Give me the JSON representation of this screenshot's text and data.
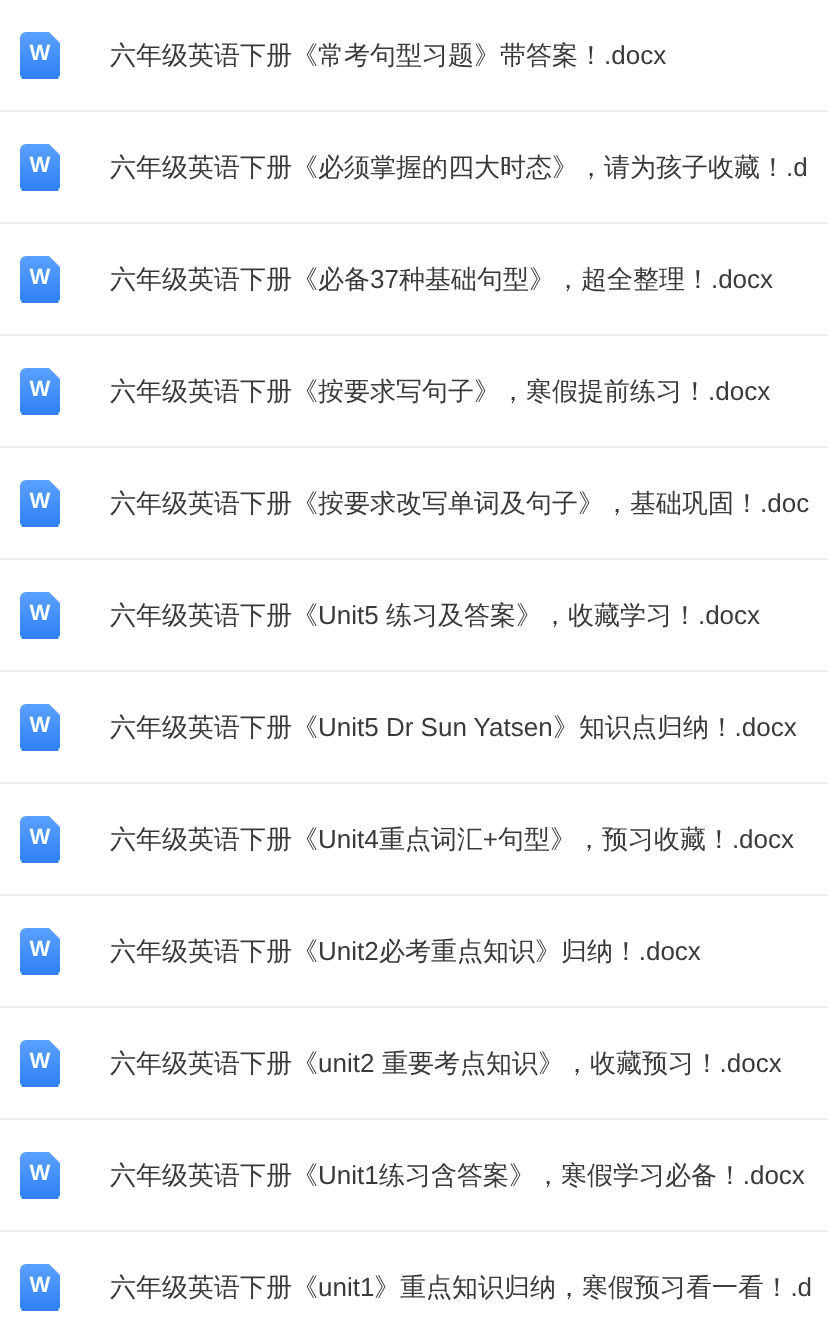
{
  "files": [
    {
      "icon_label": "W",
      "name": "六年级英语下册《常考句型习题》带答案！.docx"
    },
    {
      "icon_label": "W",
      "name": "六年级英语下册《必须掌握的四大时态》，请为孩子收藏！.d"
    },
    {
      "icon_label": "W",
      "name": "六年级英语下册《必备37种基础句型》，超全整理！.docx"
    },
    {
      "icon_label": "W",
      "name": "六年级英语下册《按要求写句子》，寒假提前练习！.docx"
    },
    {
      "icon_label": "W",
      "name": "六年级英语下册《按要求改写单词及句子》，基础巩固！.doc"
    },
    {
      "icon_label": "W",
      "name": "六年级英语下册《Unit5 练习及答案》，收藏学习！.docx"
    },
    {
      "icon_label": "W",
      "name": "六年级英语下册《Unit5 Dr Sun Yatsen》知识点归纳！.docx"
    },
    {
      "icon_label": "W",
      "name": "六年级英语下册《Unit4重点词汇+句型》，预习收藏！.docx"
    },
    {
      "icon_label": "W",
      "name": "六年级英语下册《Unit2必考重点知识》归纳！.docx"
    },
    {
      "icon_label": "W",
      "name": "六年级英语下册《unit2 重要考点知识》，收藏预习！.docx"
    },
    {
      "icon_label": "W",
      "name": "六年级英语下册《Unit1练习含答案》，寒假学习必备！.docx"
    },
    {
      "icon_label": "W",
      "name": "六年级英语下册《unit1》重点知识归纳，寒假预习看一看！.d"
    }
  ]
}
